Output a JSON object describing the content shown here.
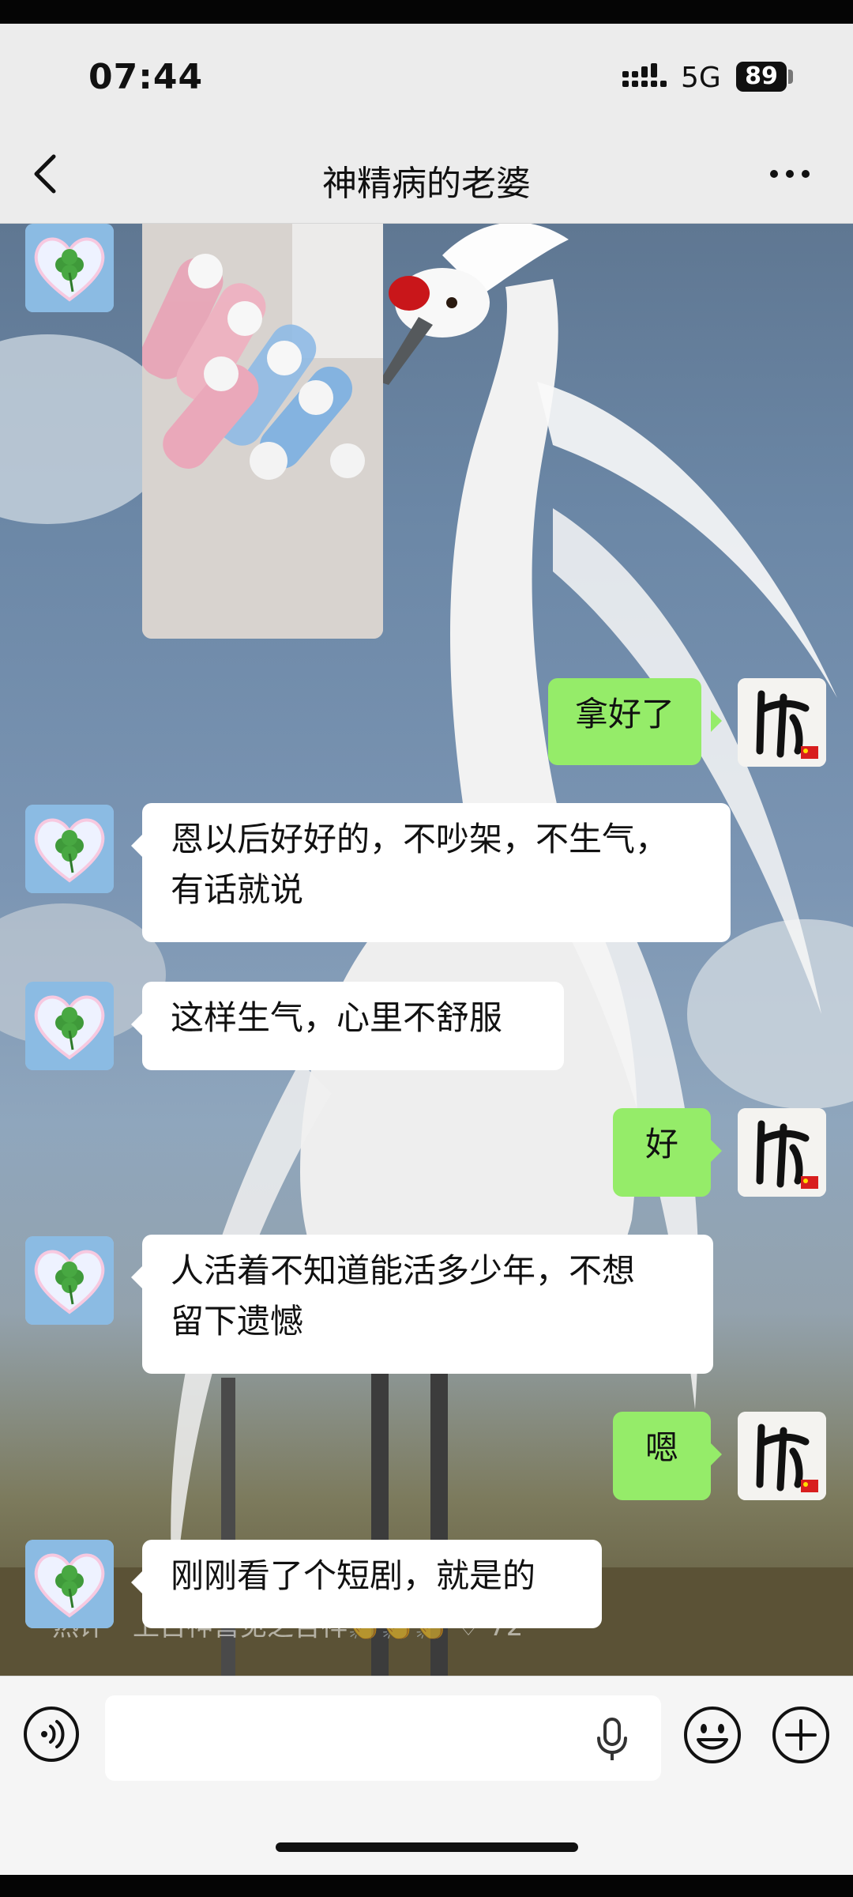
{
  "status_bar": {
    "time": "07:44",
    "network": "5G",
    "battery": "89"
  },
  "header": {
    "title": "神精病的老婆",
    "back_icon": "chevron-left-icon",
    "more_icon": "more-dots-icon"
  },
  "messages": [
    {
      "side": "left",
      "type": "image",
      "avatar": "clover-heart-avatar"
    },
    {
      "side": "right",
      "text": "拿好了",
      "avatar": "calligraphy-avatar"
    },
    {
      "side": "left",
      "line1": "恩以后好好的，不吵架，不生气，",
      "line2": "有话就说",
      "avatar": "clover-heart-avatar"
    },
    {
      "side": "left",
      "text": "这样生气，心里不舒服",
      "avatar": "clover-heart-avatar"
    },
    {
      "side": "right",
      "text": "好",
      "avatar": "calligraphy-avatar"
    },
    {
      "side": "left",
      "line1": "人活着不知道能活多少年，不想",
      "line2": "留下遗憾",
      "avatar": "clover-heart-avatar"
    },
    {
      "side": "right",
      "text": "嗯",
      "avatar": "calligraphy-avatar"
    },
    {
      "side": "left",
      "text": "刚刚看了个短剧，就是的",
      "avatar": "clover-heart-avatar"
    }
  ],
  "overlay": {
    "hot_search": "热评　上古神兽见之吉祥👏👏👏 ♡ 72"
  },
  "input_bar": {
    "voice_icon": "voice-mode-icon",
    "text_value": "",
    "mic_icon": "microphone-icon",
    "emoji_icon": "emoji-icon",
    "plus_icon": "plus-icon"
  },
  "colors": {
    "sent_bubble": "#95ec69",
    "received_bubble": "#ffffff",
    "header_bg": "#ececec"
  }
}
